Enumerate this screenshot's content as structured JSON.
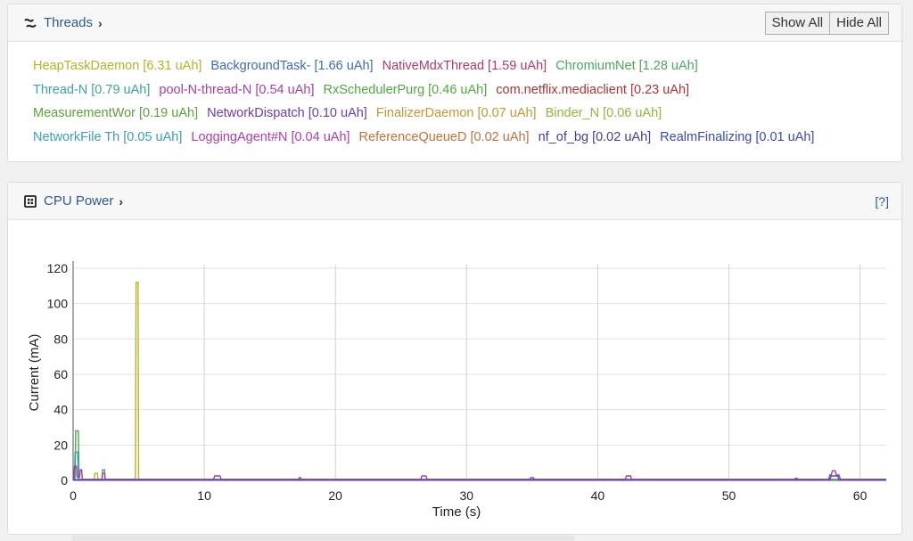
{
  "threads_panel": {
    "title": "Threads",
    "icon": "threads-icon",
    "show_all_label": "Show All",
    "hide_all_label": "Hide All",
    "legend_rows": [
      [
        {
          "label": "HeapTaskDaemon [6.31 uAh]",
          "color": "#b5b426"
        },
        {
          "label": "BackgroundTask- [1.66 uAh]",
          "color": "#3d6bb3"
        },
        {
          "label": "NativeMdxThread [1.59 uAh]",
          "color": "#b23a6b"
        },
        {
          "label": "ChromiumNet [1.28 uAh]",
          "color": "#4ba85a"
        }
      ],
      [
        {
          "label": "Thread-N [0.79 uAh]",
          "color": "#3aa3a0"
        },
        {
          "label": "pool-N-thread-N [0.54 uAh]",
          "color": "#a83ca8"
        },
        {
          "label": "RxSchedulerPurg [0.46 uAh]",
          "color": "#4caa3c"
        },
        {
          "label": "com.netflix.mediaclient [0.23 uAh]",
          "color": "#b33030"
        }
      ],
      [
        {
          "label": "MeasurementWor [0.19 uAh]",
          "color": "#5aa336"
        },
        {
          "label": "NetworkDispatch [0.10 uAh]",
          "color": "#6a3cb5"
        },
        {
          "label": "FinalizerDaemon [0.07 uAh]",
          "color": "#c7962e"
        },
        {
          "label": "Binder_N [0.06 uAh]",
          "color": "#8fb83a"
        }
      ],
      [
        {
          "label": "NetworkFile Th [0.05 uAh]",
          "color": "#3a9fb8"
        },
        {
          "label": "LoggingAgent#N [0.04 uAh]",
          "color": "#b33ab3"
        },
        {
          "label": "ReferenceQueueD [0.02 uAh]",
          "color": "#c0703a"
        },
        {
          "label": "nf_of_bg [0.02 uAh]",
          "color": "#4a3a9a"
        },
        {
          "label": "RealmFinalizing [0.01 uAh]",
          "color": "#3a4ab3"
        }
      ]
    ]
  },
  "cpu_panel": {
    "title": "CPU Power",
    "icon": "cpu-icon",
    "help_label": "[?]"
  },
  "chart_data": {
    "type": "line",
    "title": "",
    "xlabel": "Time (s)",
    "ylabel": "Current (mA)",
    "xlim": [
      0,
      62
    ],
    "ylim": [
      0,
      122
    ],
    "xticks": [
      0,
      10,
      20,
      30,
      40,
      50,
      60
    ],
    "yticks": [
      0,
      20,
      40,
      60,
      80,
      100,
      120
    ],
    "grid": true,
    "series": [
      {
        "color": "#b5b426",
        "x": [
          0,
          0.5,
          0.55,
          1.6,
          1.65,
          1.85,
          1.9,
          4.75,
          4.8,
          4.95,
          5.0,
          6,
          62
        ],
        "y": [
          0.5,
          0.5,
          0.5,
          0.5,
          4,
          4,
          0.5,
          0.5,
          112,
          112,
          0.5,
          0.5,
          0.5
        ]
      },
      {
        "color": "#4ba85a",
        "x": [
          0,
          0.15,
          0.2,
          0.4,
          0.45,
          2.2,
          2.25,
          2.4,
          2.45,
          62
        ],
        "y": [
          0.5,
          0.5,
          28,
          28,
          0.5,
          0.5,
          6,
          6,
          0.5,
          0.5
        ]
      },
      {
        "color": "#3aa3a0",
        "x": [
          0,
          0.1,
          0.15,
          0.35,
          0.4,
          0.55,
          0.6,
          62
        ],
        "y": [
          0.5,
          0.5,
          16,
          16,
          0.5,
          0.5,
          0.5,
          0.5
        ]
      },
      {
        "color": "#a83ca8",
        "x": [
          0,
          0.05,
          0.1,
          0.25,
          0.3,
          0.5,
          0.55,
          0.65,
          0.7,
          2.2,
          2.25,
          2.4,
          2.45,
          10.7,
          10.8,
          11.2,
          11.3,
          17.2,
          17.25,
          17.35,
          17.4,
          26.5,
          26.6,
          26.9,
          27.0,
          34.8,
          34.9,
          35.1,
          35.2,
          42.1,
          42.2,
          42.5,
          42.6,
          55.0,
          55.1,
          55.2,
          55.3,
          57.6,
          57.7,
          57.8,
          57.9,
          58.1,
          58.2,
          58.4,
          58.5,
          62
        ],
        "y": [
          0.5,
          0.5,
          8,
          8,
          2,
          2,
          6,
          6,
          0.5,
          0.5,
          4,
          4,
          0.5,
          0.5,
          2.5,
          2.5,
          0.5,
          0.5,
          1.5,
          1.5,
          0.5,
          0.5,
          2.5,
          2.5,
          0.5,
          0.5,
          1.5,
          1.5,
          0.5,
          0.5,
          2.5,
          2.5,
          0.5,
          0.5,
          1.2,
          1.2,
          0.5,
          0.5,
          3,
          3,
          5.5,
          5.5,
          3,
          3,
          0.5,
          0.5
        ]
      },
      {
        "color": "#6a3cb5",
        "x": [
          0,
          57.7,
          57.8,
          58.3,
          58.4,
          62
        ],
        "y": [
          0.3,
          0.3,
          2.5,
          2.5,
          0.3,
          0.3
        ]
      }
    ]
  }
}
